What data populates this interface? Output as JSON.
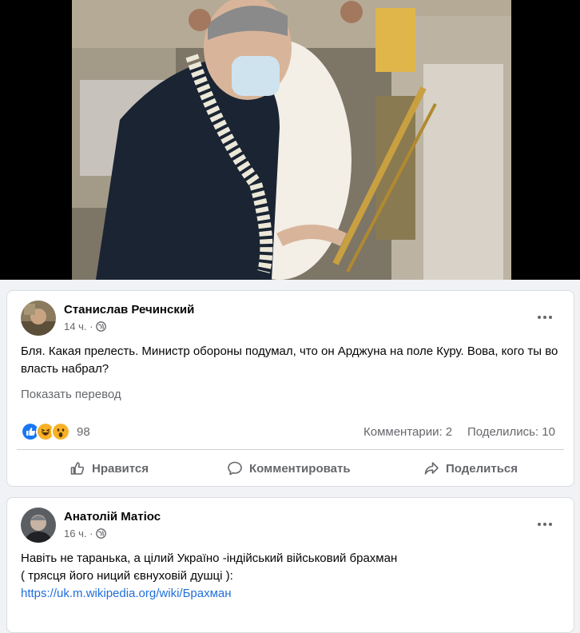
{
  "posts": [
    {
      "author": "Станислав Речинский",
      "time": "14 ч. ·",
      "text": "Бля. Какая прелесть. Министр обороны подумал, что он Арджуна на поле Куру. Вова, кого ты во власть набрал?",
      "translate": "Показать перевод",
      "reactions": {
        "icons": [
          "like-icon",
          "haha-icon",
          "wow-icon"
        ],
        "count": "98"
      },
      "comments": "Комментарии: 2",
      "shares": "Поделились: 10",
      "actions": {
        "like": "Нравится",
        "comment": "Комментировать",
        "share": "Поделиться"
      }
    },
    {
      "author": "Анатолій Матіос",
      "time": "16 ч. ·",
      "line1": "Навіть не таранька, а цілий Україно -індійський військовий брахман",
      "line2": "( трясця його ниций євнуховій душці ):",
      "link": "https://uk.m.wikipedia.org/wiki/Брахман"
    }
  ],
  "colors": {
    "link": "#216fdb",
    "muted": "#65676b",
    "like_blue": "#1877f2",
    "haha_yellow": "#f7b125"
  }
}
